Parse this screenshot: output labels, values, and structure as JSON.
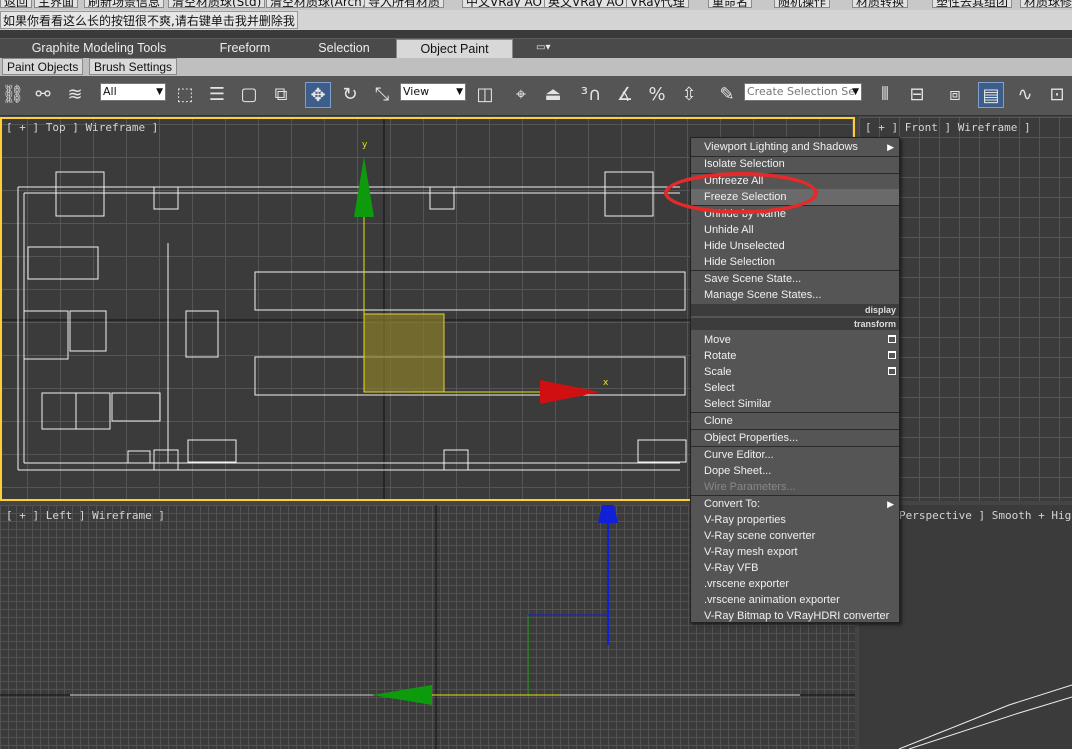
{
  "script_buttons": [
    "返回",
    "主界面",
    "刷新场景信息",
    "清空材质球(Std)",
    "清空材质球(Arch)",
    "导入所有材质",
    "中文VRay AO",
    "英文VRay AO",
    "VRay代理",
    "重命名",
    "随机操作",
    "材质转换",
    "塑性去其组团",
    "材质球修"
  ],
  "note_button": "如果你看看这么长的按钮很不爽,请右键单击我并删除我",
  "ribbon_tabs": [
    "Graphite Modeling Tools",
    "Freeform",
    "Selection",
    "Object Paint"
  ],
  "ribbon_active": "Object Paint",
  "sub_tabs": [
    "Paint Objects",
    "Brush Settings"
  ],
  "toolbar": {
    "filter_value": "All",
    "coord_value": "View",
    "selection_set_placeholder": "Create Selection Se"
  },
  "viewports": {
    "top": "[ + ] Top ] Wireframe ]",
    "front": "[ + ] Front ] Wireframe ]",
    "left": "[ + ] Left ] Wireframe ]",
    "perspective": "Perspective ] Smooth + Highli"
  },
  "gizmo": {
    "x_label": "x",
    "y_label": "y"
  },
  "quad_menu": {
    "display_header": "display",
    "transform_header": "transform",
    "items": [
      "Viewport Lighting and Shadows",
      "Isolate Selection",
      "Unfreeze All",
      "Freeze Selection",
      "Unhide by Name",
      "Unhide All",
      "Hide Unselected",
      "Hide Selection",
      "Save Scene State...",
      "Manage Scene States...",
      "Move",
      "Rotate",
      "Scale",
      "Select",
      "Select Similar",
      "Clone",
      "Object Properties...",
      "Curve Editor...",
      "Dope Sheet...",
      "Wire Parameters...",
      "Convert To:",
      "V-Ray properties",
      "V-Ray scene converter",
      "V-Ray mesh export",
      "V-Ray VFB",
      ".vrscene exporter",
      ".vrscene animation exporter",
      "V-Ray Bitmap to VRayHDRI converter"
    ]
  },
  "colors": {
    "annotation": "#e52a2a",
    "active_viewport_border": "#ffcf33",
    "gizmo_y": "#0d9b0d",
    "gizmo_x": "#d01010",
    "gizmo_z": "#1020d8"
  }
}
